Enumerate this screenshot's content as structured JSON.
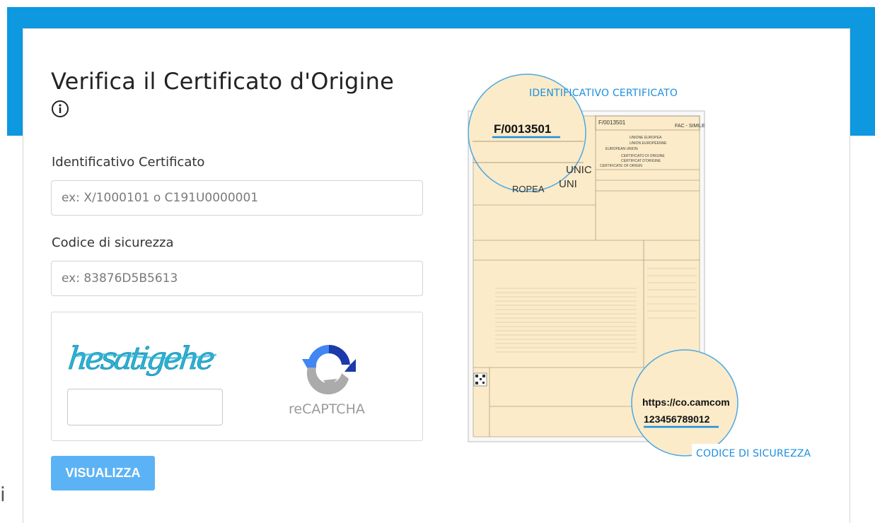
{
  "page": {
    "title": "Verifica il Certificato d'Origine",
    "info_icon": "info-circle-icon",
    "left_glyph": "i"
  },
  "form": {
    "id_label": "Identificativo Certificato",
    "id_placeholder": "ex: X/1000101 o C191U0000001",
    "code_label": "Codice di sicurezza",
    "code_placeholder": "ex: 83876D5B5613",
    "captcha_text": "hesatigehe",
    "recaptcha_label": "reCAPTCHA",
    "submit_label": "VISUALIZZA"
  },
  "certificate": {
    "callout_top": "IDENTIFICATIVO CERTIFICATO",
    "callout_bottom": "CODICE DI SICUREZZA",
    "magnified_id": "F/0013501",
    "magnified_url": "https://co.camcom",
    "magnified_code": "123456789012",
    "header_number": "F/0013501",
    "facsimile": "FAC - SIMILE",
    "doc_lines": [
      "UNIONE EUROPEA",
      "UNION EUROPÉENNE",
      "EUROPEAN UNION",
      "CERTIFICATO DI ORIGINE",
      "CERTIFICAT D'ORIGINE",
      "CERTIFICATE OF ORIGIN"
    ],
    "magnified_left_text_1": "UNIC",
    "magnified_left_text_2": "UNI",
    "magnified_left_text_3": "ROPEA"
  },
  "colors": {
    "brand_blue": "#0d98e0",
    "button_blue": "#5bb3f5",
    "callout_blue": "#1c8fdf",
    "paper": "#fbebc8",
    "captcha_ink": "#2ab3d6"
  }
}
